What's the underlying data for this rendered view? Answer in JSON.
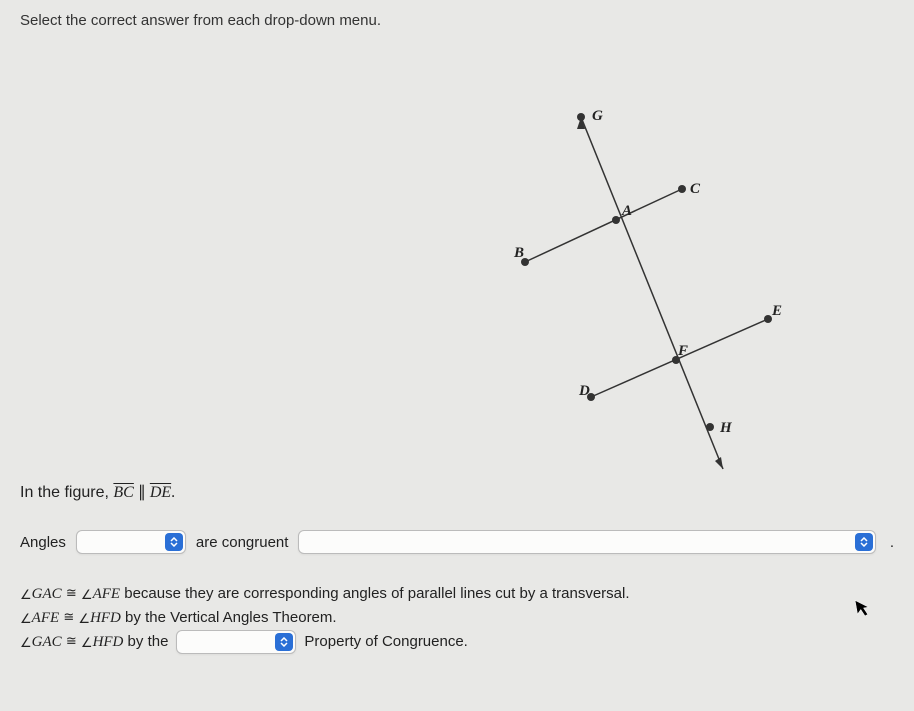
{
  "instruction": "Select the correct answer from each drop-down menu.",
  "figure": {
    "labels": {
      "G": "G",
      "C": "C",
      "A": "A",
      "B": "B",
      "E": "E",
      "F": "F",
      "D": "D",
      "H": "H"
    }
  },
  "given": {
    "prefix": "In the figure, ",
    "seg1": "BC",
    "parallel": " ∥ ",
    "seg2": "DE",
    "suffix": "."
  },
  "sentence1": {
    "word_angles": "Angles",
    "word_are_congruent": "are congruent",
    "period": "."
  },
  "proof": {
    "line1": {
      "angle1": "GAC",
      "angle2": "AFE",
      "reason": " because they are corresponding angles of parallel lines cut by a transversal."
    },
    "line2": {
      "angle1": "AFE",
      "angle2": "HFD",
      "reason": " by the Vertical Angles Theorem."
    },
    "line3": {
      "angle1": "GAC",
      "angle2": "HFD",
      "by_the": " by the",
      "suffix": "Property of Congruence."
    }
  },
  "icons": {
    "dropdown": "updown-caret-icon",
    "cursor": "cursor-icon"
  }
}
